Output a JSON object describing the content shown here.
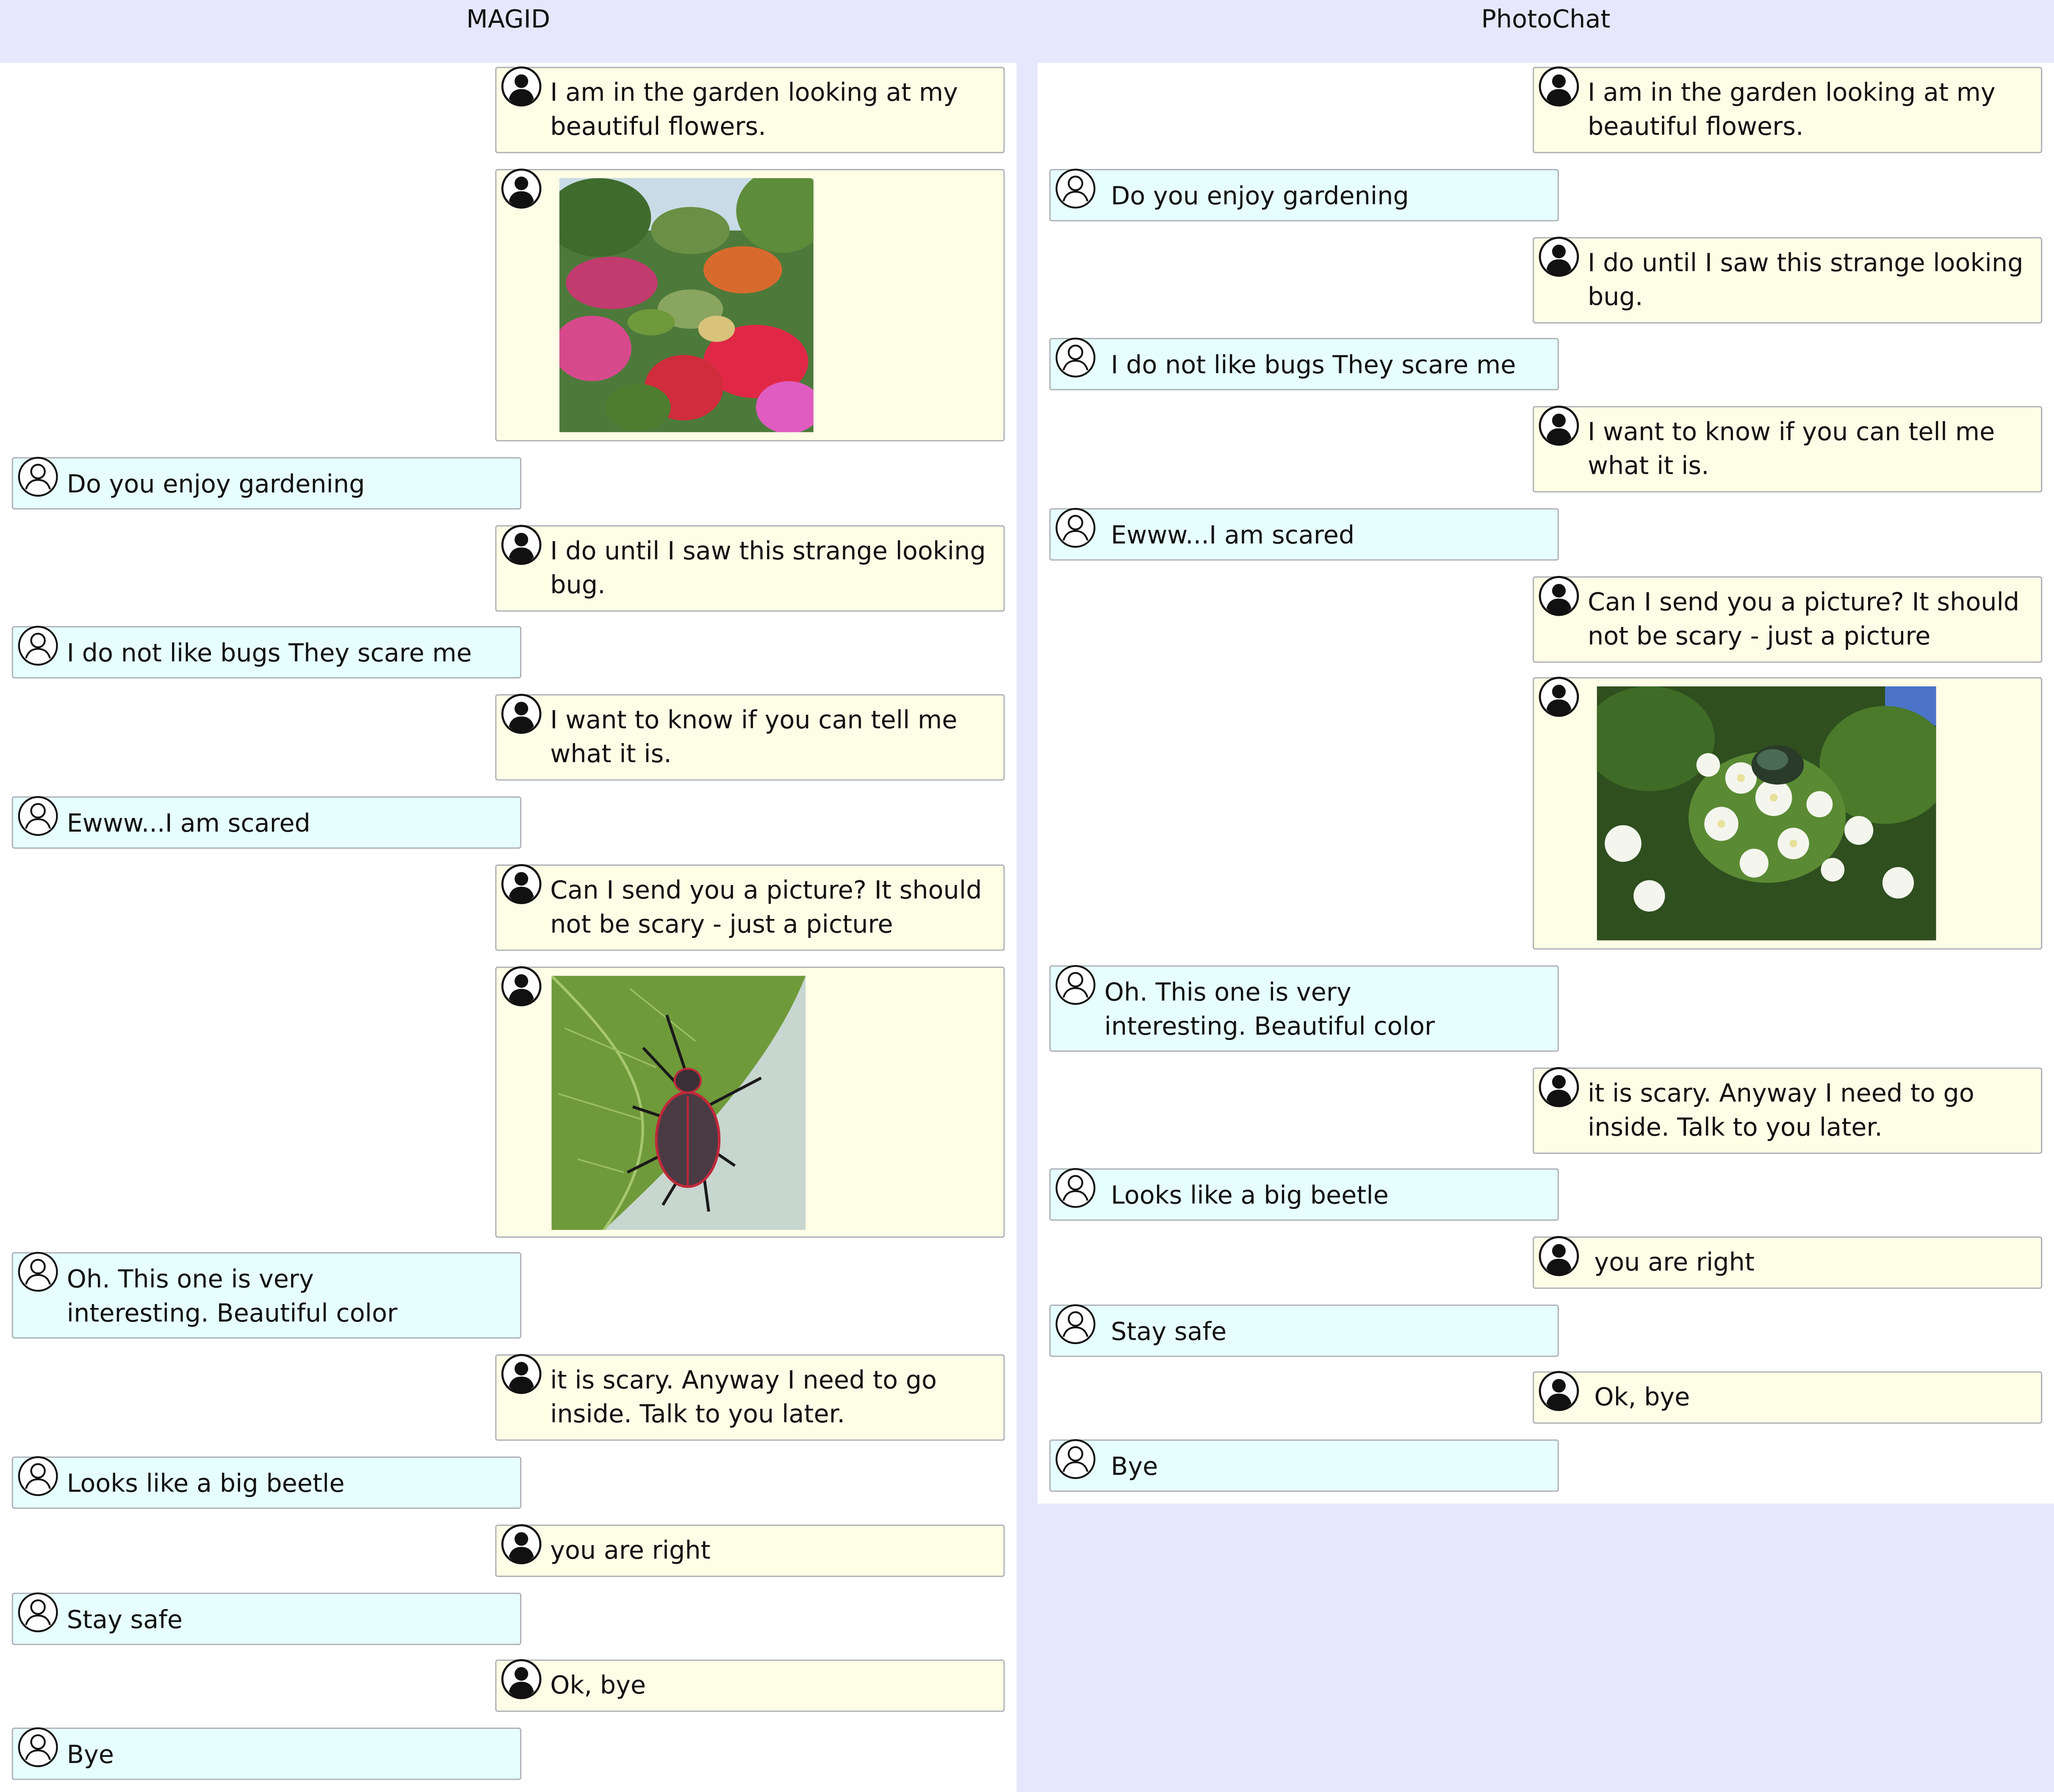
{
  "panels": {
    "left": {
      "title": "MAGID",
      "messages": [
        {
          "role": "user",
          "text": "I am in the garden looking at my beautiful flowers."
        },
        {
          "role": "user",
          "image": "garden-flowers-image"
        },
        {
          "role": "bot",
          "text": "Do you enjoy gardening"
        },
        {
          "role": "user",
          "text": "I do until I saw this strange looking bug."
        },
        {
          "role": "bot",
          "text": "I do not like bugs They scare me"
        },
        {
          "role": "user",
          "text": "I want to know if you can tell me what it is."
        },
        {
          "role": "bot",
          "text": "Ewww...I am scared"
        },
        {
          "role": "user",
          "text": "Can I send you a picture? It should not be scary - just a picture"
        },
        {
          "role": "user",
          "image": "beetle-on-leaf-image"
        },
        {
          "role": "bot",
          "text": "Oh. This one is very interesting. Beautiful color"
        },
        {
          "role": "user",
          "text": "it is scary. Anyway I need to go inside. Talk to you later."
        },
        {
          "role": "bot",
          "text": "Looks like a big beetle"
        },
        {
          "role": "user",
          "text": "you are right"
        },
        {
          "role": "bot",
          "text": "Stay safe"
        },
        {
          "role": "user",
          "text": "Ok, bye"
        },
        {
          "role": "bot",
          "text": "Bye"
        }
      ]
    },
    "right": {
      "title": "PhotoChat",
      "messages": [
        {
          "role": "user",
          "text": "I am in the garden looking at my beautiful flowers."
        },
        {
          "role": "bot",
          "text": "Do you enjoy gardening"
        },
        {
          "role": "user",
          "text": "I do until I saw this strange looking bug."
        },
        {
          "role": "bot",
          "text": "I do not like bugs They scare me"
        },
        {
          "role": "user",
          "text": "I want to know if you can tell me what it is."
        },
        {
          "role": "bot",
          "text": "Ewww...I am scared"
        },
        {
          "role": "user",
          "text": "Can I send you a picture? It should not be scary - just a picture"
        },
        {
          "role": "user",
          "image": "beetle-on-white-flowers-image"
        },
        {
          "role": "bot",
          "text": "Oh. This one is very interesting. Beautiful color"
        },
        {
          "role": "user",
          "text": "it is scary. Anyway I need to go inside. Talk to you later."
        },
        {
          "role": "bot",
          "text": "Looks like a big beetle"
        },
        {
          "role": "user",
          "text": "you are right"
        },
        {
          "role": "bot",
          "text": "Stay safe"
        },
        {
          "role": "user",
          "text": "Ok, bye"
        },
        {
          "role": "bot",
          "text": "Bye"
        }
      ]
    }
  },
  "colors": {
    "page_background": "#e6e6fc",
    "bot_bubble": "#e6fffe",
    "user_bubble": "#fefde6",
    "bubble_border": "#aeb2b8"
  },
  "icons": {
    "user_avatar": "person-filled-icon",
    "bot_avatar": "person-outline-icon"
  }
}
